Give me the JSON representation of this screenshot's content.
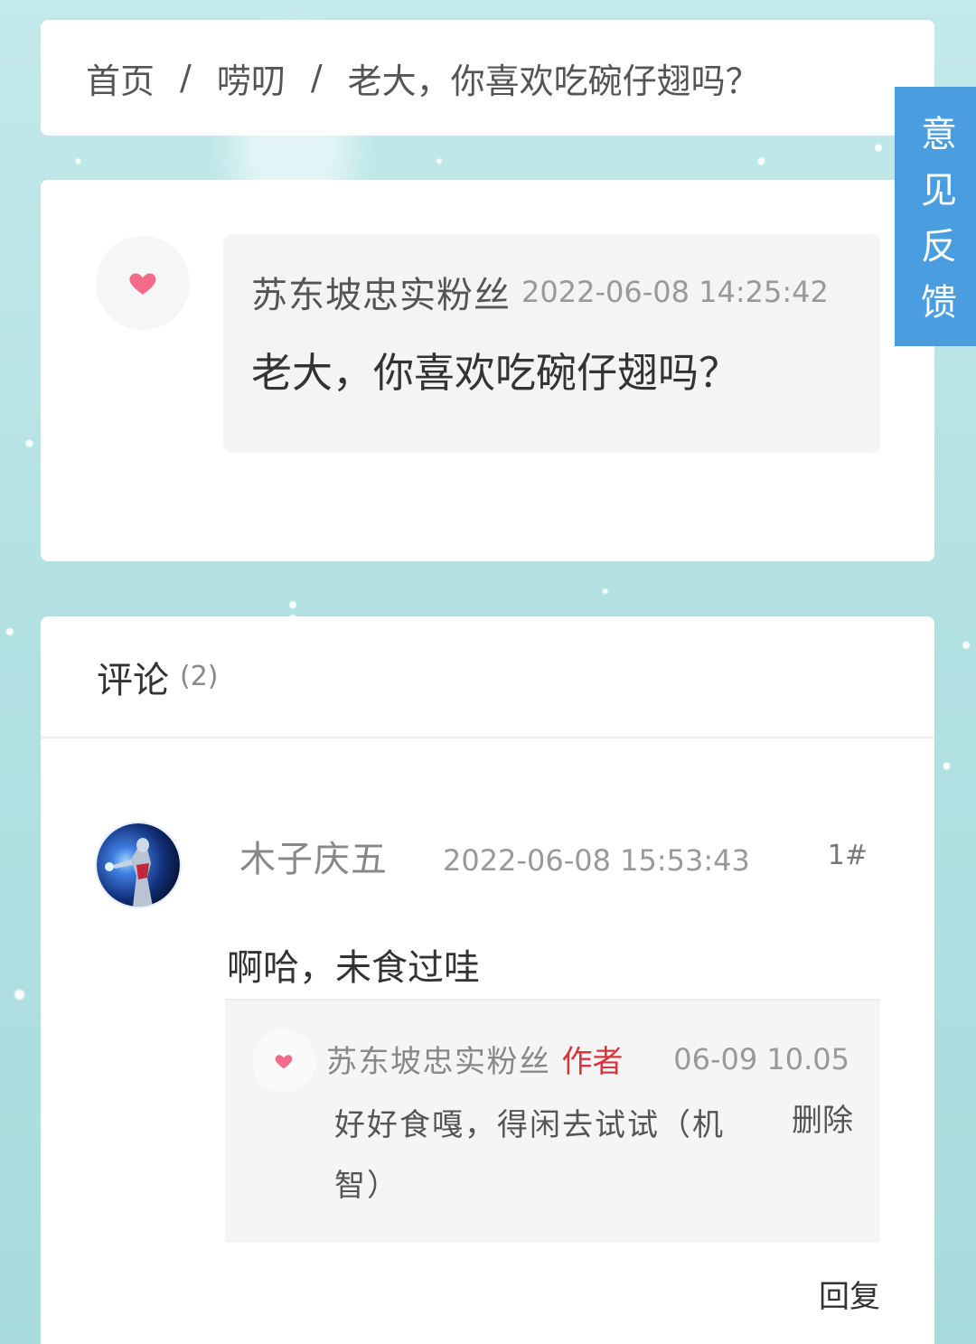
{
  "breadcrumb": {
    "items": [
      "首页",
      "唠叨",
      "老大，你喜欢吃碗仔翅吗？"
    ],
    "separator": "/"
  },
  "feedback_tab": {
    "label": "意见反馈"
  },
  "post": {
    "avatar_icon": "heart-icon",
    "author": "苏东坡忠实粉丝",
    "time": "2022-06-08 14:25:42",
    "content": "老大，你喜欢吃碗仔翅吗？"
  },
  "comments": {
    "title": "评论",
    "count": "(2)",
    "items": [
      {
        "author": "木子庆五",
        "time": "2022-06-08 15:53:43",
        "floor": "1#",
        "content": "啊哈，未食过哇",
        "reply_label": "回复",
        "replies": [
          {
            "avatar_icon": "heart-icon",
            "author": "苏东坡忠实粉丝",
            "badge": "作者",
            "time": "06-09 10.05",
            "content": "好好食嘎，得闲去试试（机智）",
            "delete_label": "删除"
          }
        ]
      }
    ]
  },
  "colors": {
    "feedback_tab": "#4a9ee0",
    "author_badge": "#d9333f",
    "heart": "#f26b8a"
  }
}
